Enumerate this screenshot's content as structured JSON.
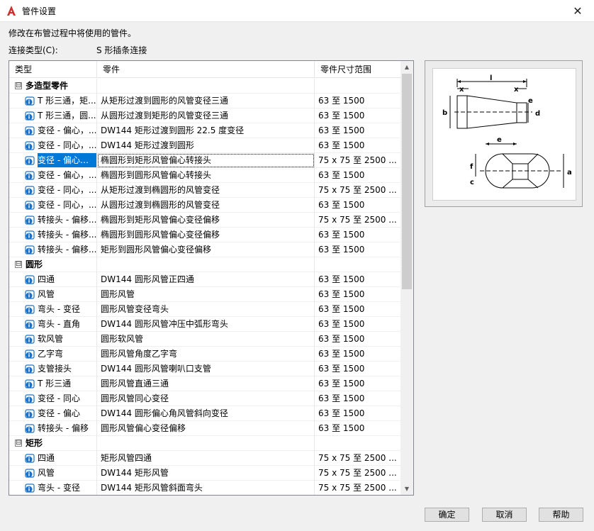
{
  "window": {
    "title": "管件设置",
    "close_glyph": "✕"
  },
  "description": "修改在布管过程中将使用的管件。",
  "connection": {
    "label": "连接类型(C):",
    "value": "S 形插条连接"
  },
  "table": {
    "headers": [
      "类型",
      "零件",
      "零件尺寸范围"
    ],
    "rows": [
      {
        "group": true,
        "expander": "⊟",
        "label": "多造型零件"
      },
      {
        "type": "T 形三通，矩...",
        "part": "从矩形过渡到圆形的风管变径三通",
        "range": "63 至 1500"
      },
      {
        "type": "T 形三通，圆...",
        "part": "从圆形过渡到矩形的风管变径三通",
        "range": "63 至 1500"
      },
      {
        "type": "变径 - 偏心，...",
        "part": "DW144 矩形过渡到圆形 22.5 度变径",
        "range": "63 至 1500"
      },
      {
        "type": "变径 - 同心，...",
        "part": "DW144 矩形过渡到圆形",
        "range": "63 至 1500"
      },
      {
        "type": "变径 - 偏心，...",
        "part": "椭圆形到矩形风管偏心转接头",
        "range": "75 x 75 至 2500 ...",
        "selected": true
      },
      {
        "type": "变径 - 偏心，...",
        "part": "椭圆形到圆形风管偏心转接头",
        "range": "63 至 1500"
      },
      {
        "type": "变径 - 同心，...",
        "part": "从矩形过渡到椭圆形的风管变径",
        "range": "75 x 75 至 2500 ..."
      },
      {
        "type": "变径 - 同心，...",
        "part": "从圆形过渡到椭圆形的风管变径",
        "range": "63 至 1500"
      },
      {
        "type": "转接头 - 偏移...",
        "part": "椭圆形到矩形风管偏心变径偏移",
        "range": "75 x 75 至 2500 ..."
      },
      {
        "type": "转接头 - 偏移...",
        "part": "椭圆形到圆形风管偏心变径偏移",
        "range": "63 至 1500"
      },
      {
        "type": "转接头 - 偏移...",
        "part": "矩形到圆形风管偏心变径偏移",
        "range": "63 至 1500"
      },
      {
        "group": true,
        "expander": "⊟",
        "label": "圆形"
      },
      {
        "type": "四通",
        "part": "DW144  圆形风管正四通",
        "range": "63 至 1500"
      },
      {
        "type": "风管",
        "part": "圆形风管",
        "range": "63 至 1500"
      },
      {
        "type": "弯头 - 变径",
        "part": "圆形风管变径弯头",
        "range": "63 至 1500"
      },
      {
        "type": "弯头 - 直角",
        "part": "DW144 圆形风管冲压中弧形弯头",
        "range": "63 至 1500"
      },
      {
        "type": "软风管",
        "part": "圆形软风管",
        "range": "63 至 1500"
      },
      {
        "type": "乙字弯",
        "part": "圆形风管角度乙字弯",
        "range": "63 至 1500"
      },
      {
        "type": "支管接头",
        "part": "DW144 圆形风管喇叭口支管",
        "range": "63 至 1500"
      },
      {
        "type": "T 形三通",
        "part": "圆形风管直通三通",
        "range": "63 至 1500"
      },
      {
        "type": "变径 - 同心",
        "part": "圆形风管同心变径",
        "range": "63 至 1500"
      },
      {
        "type": "变径 - 偏心",
        "part": "DW144 圆形偏心角风管斜向变径",
        "range": "63 至 1500"
      },
      {
        "type": "转接头 - 偏移",
        "part": "圆形风管偏心变径偏移",
        "range": "63 至 1500"
      },
      {
        "group": true,
        "expander": "⊟",
        "label": "矩形"
      },
      {
        "type": "四通",
        "part": "矩形风管四通",
        "range": "75 x 75 至 2500 ..."
      },
      {
        "type": "风管",
        "part": "DW144 矩形风管",
        "range": "75 x 75 至 2500 ..."
      },
      {
        "type": "弯头 - 变径",
        "part": "DW144  矩形风管斜面弯头",
        "range": "75 x 75 至 2500 ..."
      }
    ]
  },
  "scrollbar": {
    "up": "▲",
    "down": "▼"
  },
  "preview": {
    "labels": {
      "l": "l",
      "x1": "x",
      "x2": "x",
      "b": "b",
      "e_top": "e",
      "d": "d",
      "e_bottom": "e",
      "f": "f",
      "c": "c",
      "a": "a"
    }
  },
  "buttons": {
    "ok": "确定",
    "cancel": "取消",
    "help": "帮助"
  },
  "colors": {
    "selection": "#0078d7",
    "icon": "#1a73c9",
    "accent": "#d22d2d"
  }
}
